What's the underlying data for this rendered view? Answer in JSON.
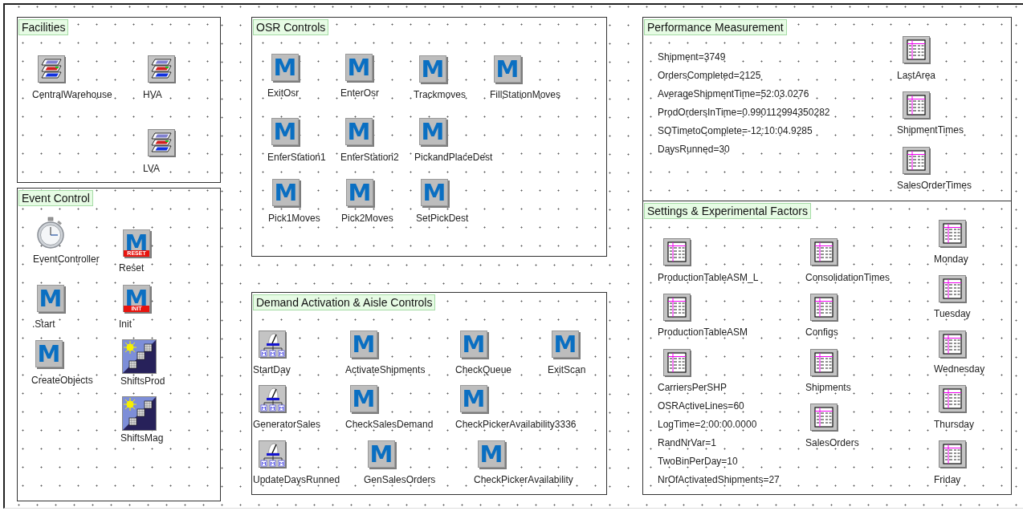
{
  "frames": [
    {
      "title": "Facilities",
      "items": [
        {
          "kind": "facility",
          "label": "CentralWarehouse"
        },
        {
          "kind": "facility",
          "label": "HVA"
        },
        {
          "kind": "facility",
          "label": "LVA"
        }
      ]
    },
    {
      "title": "Event Control",
      "items": [
        {
          "kind": "stopwatch",
          "label": "EventController"
        },
        {
          "kind": "method",
          "label": ".Start",
          "icon_text": "M"
        },
        {
          "kind": "method",
          "label": "CreateObjects",
          "icon_text": "M"
        },
        {
          "kind": "method",
          "label": "Reset",
          "icon_text": "M",
          "badge": "RESET"
        },
        {
          "kind": "method",
          "label": "Init",
          "icon_text": "M",
          "badge": "INIT"
        },
        {
          "kind": "shift-calendar",
          "label": "ShiftsProd"
        },
        {
          "kind": "shift-calendar",
          "label": "ShiftsMag"
        }
      ]
    },
    {
      "title": "OSR Controls",
      "items": [
        {
          "kind": "method",
          "label": "ExitOsr",
          "icon_text": "M"
        },
        {
          "kind": "method",
          "label": "EnterOsr",
          "icon_text": "M"
        },
        {
          "kind": "method",
          "label": "Trackmoves",
          "icon_text": "M"
        },
        {
          "kind": "method",
          "label": "FillStationMoves",
          "icon_text": "M"
        },
        {
          "kind": "method",
          "label": "EnterStation1",
          "icon_text": "M"
        },
        {
          "kind": "method",
          "label": "EnterStation2",
          "icon_text": "M"
        },
        {
          "kind": "method",
          "label": "PickandPlaceDest",
          "icon_text": "M"
        },
        {
          "kind": "method",
          "label": "Pick1Moves",
          "icon_text": "M"
        },
        {
          "kind": "method",
          "label": "Pick2Moves",
          "icon_text": "M"
        },
        {
          "kind": "method",
          "label": "SetPickDest",
          "icon_text": "M"
        }
      ]
    },
    {
      "title": "Demand Activation & Aisle Controls",
      "items": [
        {
          "kind": "generator",
          "label": "StartDay"
        },
        {
          "kind": "method",
          "label": "ActivateShipments",
          "icon_text": "M"
        },
        {
          "kind": "method",
          "label": "CheckQueue",
          "icon_text": "M"
        },
        {
          "kind": "method",
          "label": "ExitScan",
          "icon_text": "M"
        },
        {
          "kind": "generator",
          "label": "GeneratorSales"
        },
        {
          "kind": "method",
          "label": "CheckSalesDemand",
          "icon_text": "M"
        },
        {
          "kind": "method",
          "label": "CheckPickerAvailability3336",
          "icon_text": "M"
        },
        {
          "kind": "generator",
          "label": "UpdateDaysRunned"
        },
        {
          "kind": "method",
          "label": "GenSalesOrders",
          "icon_text": "M"
        },
        {
          "kind": "method",
          "label": "CheckPickerAvailability",
          "icon_text": "M"
        }
      ]
    },
    {
      "title": "Performance Measurement",
      "items": [
        {
          "kind": "variable",
          "label": "Shipment=3749"
        },
        {
          "kind": "variable",
          "label": "OrdersCompleted=2125"
        },
        {
          "kind": "variable",
          "label": "AverageShipmentTime=52:03.0276"
        },
        {
          "kind": "variable",
          "label": "ProdOrdersInTime=0.990112994350282"
        },
        {
          "kind": "variable",
          "label": "SOTimetoComplete=-12:10:04.9285"
        },
        {
          "kind": "variable",
          "label": "DaysRunned=30"
        },
        {
          "kind": "table",
          "label": "LastArea"
        },
        {
          "kind": "table",
          "label": "ShipmentTimes"
        },
        {
          "kind": "table",
          "label": "SalesOrderTimes"
        }
      ]
    },
    {
      "title": "Settings & Experimental Factors",
      "items": [
        {
          "kind": "table",
          "label": "ProductionTableASM_L"
        },
        {
          "kind": "table",
          "label": "ProductionTableASM"
        },
        {
          "kind": "table",
          "label": "CarriersPerSHP"
        },
        {
          "kind": "variable",
          "label": "OSRActiveLines=60"
        },
        {
          "kind": "variable",
          "label": "LogTime=2:00:00.0000"
        },
        {
          "kind": "variable",
          "label": "RandNrVar=1"
        },
        {
          "kind": "variable",
          "label": "TwoBinPerDay=10"
        },
        {
          "kind": "variable",
          "label": "NrOfActivatedShipments=27"
        },
        {
          "kind": "table",
          "label": "ConsolidationTimes"
        },
        {
          "kind": "table",
          "label": "Configs"
        },
        {
          "kind": "table",
          "label": "Shipments"
        },
        {
          "kind": "table",
          "label": "SalesOrders"
        },
        {
          "kind": "table",
          "label": "Monday"
        },
        {
          "kind": "table",
          "label": "Tuesday"
        },
        {
          "kind": "table",
          "label": "Wednesday"
        },
        {
          "kind": "table",
          "label": "Thursday"
        },
        {
          "kind": "table",
          "label": "Friday"
        }
      ]
    }
  ]
}
